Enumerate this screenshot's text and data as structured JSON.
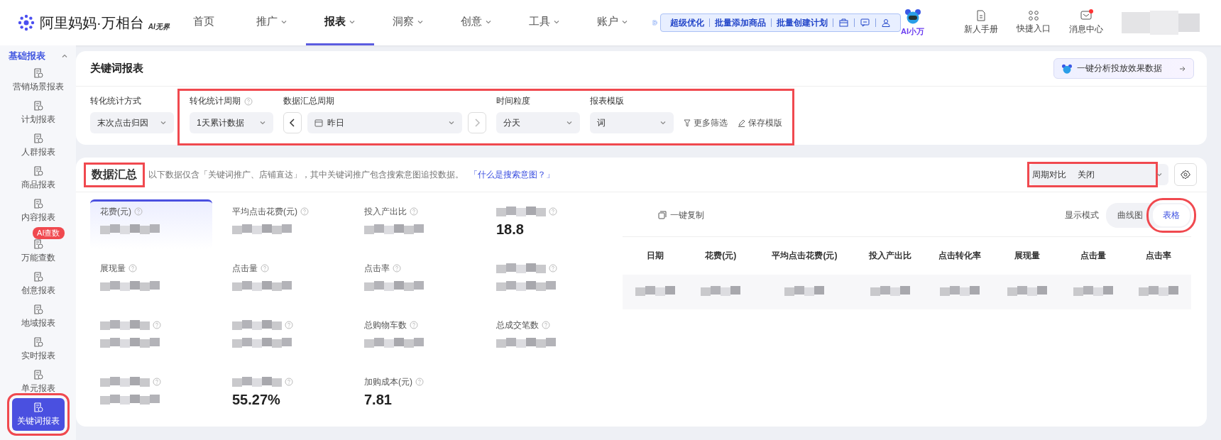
{
  "topbar": {
    "logo": "阿里妈妈·万相台",
    "logo_tag": "AI无界",
    "nav": [
      {
        "label": "首页",
        "dropdown": false,
        "selected": false
      },
      {
        "label": "推广",
        "dropdown": true,
        "selected": false
      },
      {
        "label": "报表",
        "dropdown": true,
        "selected": true
      },
      {
        "label": "洞察",
        "dropdown": true,
        "selected": false
      },
      {
        "label": "创意",
        "dropdown": true,
        "selected": false
      },
      {
        "label": "工具",
        "dropdown": true,
        "selected": false
      },
      {
        "label": "账户",
        "dropdown": true,
        "selected": false
      }
    ],
    "toolbar": [
      "超级优化",
      "批量添加商品",
      "批量创建计划"
    ],
    "assistant": "AI小万",
    "actions": [
      {
        "label": "新人手册",
        "kind": "manual",
        "dot": false
      },
      {
        "label": "快捷入口",
        "kind": "grid",
        "dot": false
      },
      {
        "label": "消息中心",
        "kind": "message",
        "dot": true
      }
    ]
  },
  "sidebar": {
    "heading": "基础报表",
    "expanded": true,
    "items": [
      {
        "label": "营销场景报表",
        "selected": false,
        "highlighted": false
      },
      {
        "label": "计划报表",
        "selected": false,
        "highlighted": false
      },
      {
        "label": "人群报表",
        "selected": false,
        "highlighted": false
      },
      {
        "label": "商品报表",
        "selected": false,
        "highlighted": false
      },
      {
        "label": "内容报表",
        "selected": false,
        "highlighted": false
      },
      {
        "label": "万能查数",
        "badge": "AI查数",
        "selected": false,
        "highlighted": false
      },
      {
        "label": "创意报表",
        "selected": false,
        "highlighted": false
      },
      {
        "label": "地域报表",
        "selected": false,
        "highlighted": false
      },
      {
        "label": "实时报表",
        "selected": false,
        "highlighted": false
      },
      {
        "label": "单元报表",
        "selected": false,
        "highlighted": false
      },
      {
        "label": "关键词报表",
        "selected": true,
        "highlighted": true
      }
    ]
  },
  "report": {
    "title": "关键词报表",
    "analyze_button": "一键分析投放效果数据",
    "filters": [
      {
        "label": "转化统计方式",
        "value": "末次点击归因",
        "help": false,
        "kind": "select"
      }
    ],
    "filter_group": {
      "highlighted": true,
      "filters": [
        {
          "label": "转化统计周期",
          "value": "1天累计数据",
          "help": true,
          "kind": "select"
        },
        {
          "label": "数据汇总周期",
          "value": "昨日",
          "help": false,
          "kind": "date"
        },
        {
          "label": "时间粒度",
          "value": "分天",
          "help": false,
          "kind": "select"
        },
        {
          "label": "报表模版",
          "value": "词",
          "help": false,
          "kind": "select"
        }
      ]
    },
    "links": [
      {
        "label": "更多筛选",
        "kind": "filter"
      },
      {
        "label": "保存模版",
        "kind": "edit"
      }
    ]
  },
  "summary": {
    "title": "数据汇总",
    "title_highlighted": true,
    "note": "以下数据仅含「关键词推广、店铺直达」，其中关键词推广包含搜索意图追投数据。",
    "note_link": "「什么是搜索意图？」",
    "compare_label": "周期对比",
    "compare_value": "关闭",
    "compare_highlighted": true,
    "metrics": [
      {
        "label": "花费(元)",
        "selected": true
      },
      {
        "label": "平均点击花费(元)",
        "selected": false
      },
      {
        "label": "投入产出比",
        "selected": false
      },
      {
        "value": "18.8",
        "selected": false
      },
      {
        "label": "展现量",
        "selected": false
      },
      {
        "label": "点击量",
        "selected": false
      },
      {
        "label": "点击率",
        "selected": false
      },
      {
        "selected": false
      },
      {
        "selected": false
      },
      {
        "selected": false
      },
      {
        "label": "总购物车数",
        "selected": false
      },
      {
        "label": "总成交笔数",
        "selected": false
      },
      {
        "selected": false
      },
      {
        "value": "55.27%",
        "selected": false
      },
      {
        "label": "加购成本(元)",
        "value": "7.81",
        "selected": false
      }
    ],
    "copy_button": "一键复制",
    "mode_label": "显示模式",
    "modes": [
      {
        "label": "曲线图",
        "selected": false,
        "highlighted": false
      },
      {
        "label": "表格",
        "selected": true,
        "highlighted": true
      }
    ],
    "table": {
      "columns": [
        "日期",
        "花费(元)",
        "平均点击花费(元)",
        "投入产出比",
        "点击转化率",
        "展现量",
        "点击量",
        "点击率"
      ]
    }
  }
}
